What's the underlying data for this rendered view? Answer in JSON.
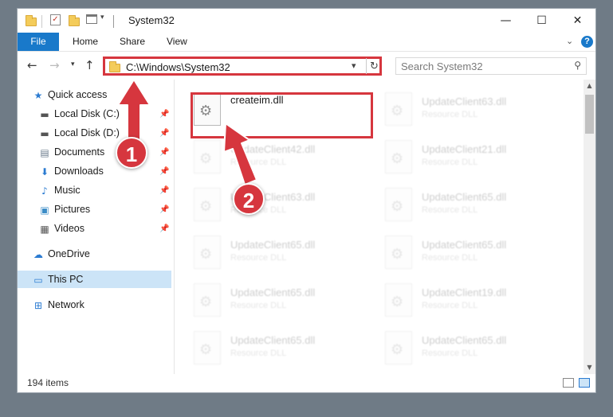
{
  "window": {
    "title": "System32",
    "controls": {
      "minimize": "—",
      "maximize": "☐",
      "close": "✕"
    }
  },
  "ribbon": {
    "tabs": [
      "File",
      "Home",
      "Share",
      "View"
    ],
    "help": "?"
  },
  "address": {
    "path": "C:\\Windows\\System32",
    "search_placeholder": "Search System32"
  },
  "nav": {
    "items": [
      {
        "label": "Quick access",
        "icon": "star-icon"
      },
      {
        "label": "Local Disk (C:)",
        "icon": "drive-icon",
        "pinned": true
      },
      {
        "label": "Local Disk (D:)",
        "icon": "drive-icon",
        "pinned": true
      },
      {
        "label": "Documents",
        "icon": "documents-icon",
        "pinned": true
      },
      {
        "label": "Downloads",
        "icon": "downloads-icon",
        "pinned": true
      },
      {
        "label": "Music",
        "icon": "music-icon",
        "pinned": true
      },
      {
        "label": "Pictures",
        "icon": "pictures-icon",
        "pinned": true
      },
      {
        "label": "Videos",
        "icon": "videos-icon",
        "pinned": true
      },
      {
        "label": "OneDrive",
        "icon": "cloud-icon"
      },
      {
        "label": "This PC",
        "icon": "computer-icon",
        "selected": true
      },
      {
        "label": "Network",
        "icon": "network-icon"
      }
    ]
  },
  "files": [
    {
      "name": "createim.dll",
      "type": "",
      "highlighted": true
    },
    {
      "name": "UpdateClient63.dll",
      "type": "Resource DLL"
    },
    {
      "name": "UpdateClient42.dll",
      "type": "Resource DLL"
    },
    {
      "name": "UpdateClient21.dll",
      "type": "Resource DLL"
    },
    {
      "name": "UpdateClient63.dll",
      "type": "Resource DLL"
    },
    {
      "name": "UpdateClient65.dll",
      "type": "Resource DLL"
    },
    {
      "name": "UpdateClient65.dll",
      "type": "Resource DLL"
    },
    {
      "name": "UpdateClient65.dll",
      "type": "Resource DLL"
    },
    {
      "name": "UpdateClient65.dll",
      "type": "Resource DLL"
    },
    {
      "name": "UpdateClient19.dll",
      "type": "Resource DLL"
    },
    {
      "name": "UpdateClient65.dll",
      "type": "Resource DLL"
    },
    {
      "name": "UpdateClient65.dll",
      "type": "Resource DLL"
    }
  ],
  "status": {
    "item_count": "194 items"
  },
  "annotations": {
    "step1": "1",
    "step2": "2",
    "color": "#d6363e"
  }
}
